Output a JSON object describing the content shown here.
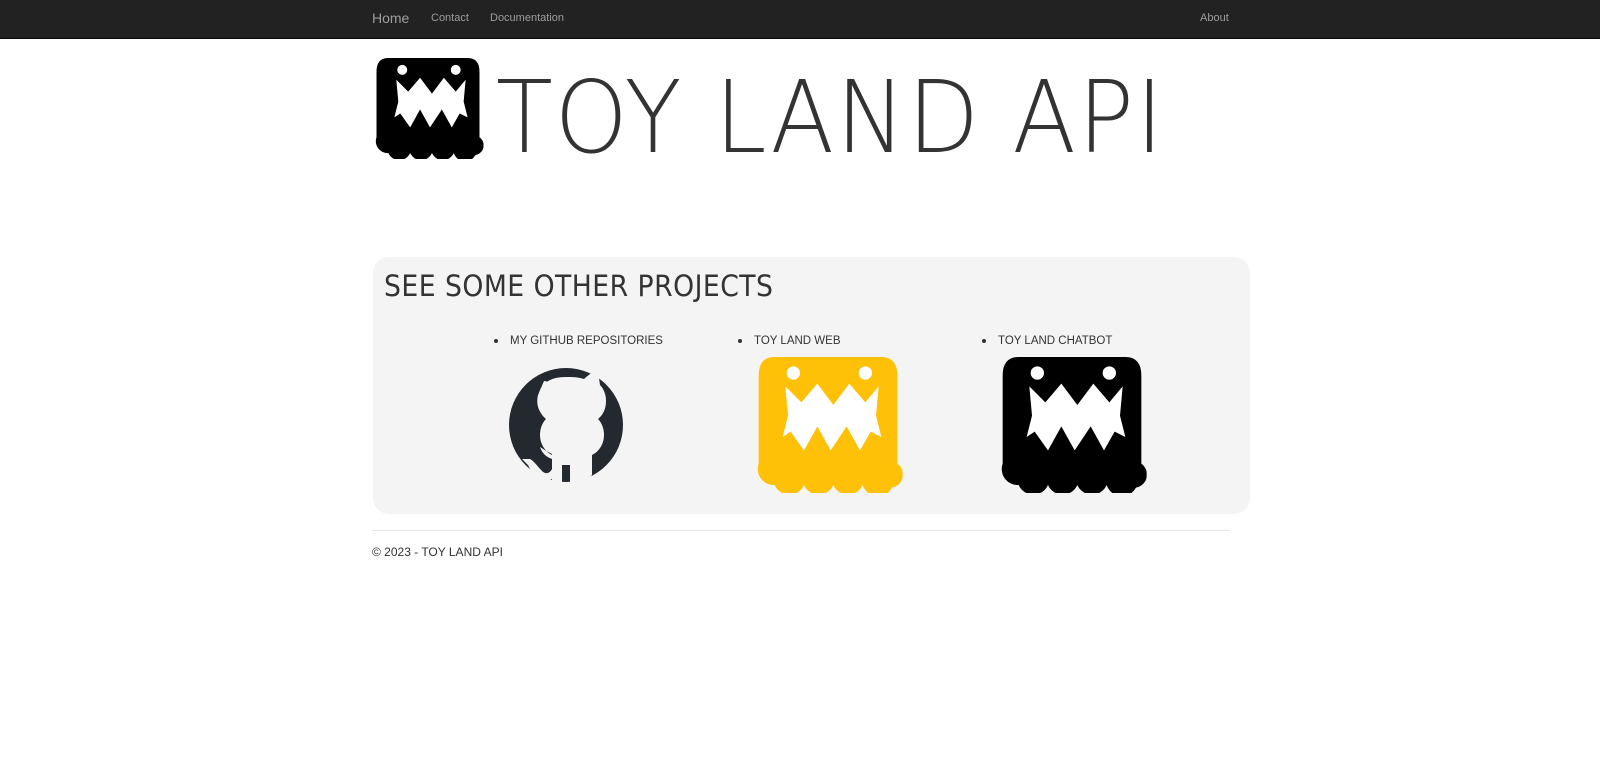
{
  "nav": {
    "brand": "Home",
    "links": [
      "Contact",
      "Documentation"
    ],
    "right_link": "About"
  },
  "hero": {
    "title": "TOY LAND API",
    "logo_icon": "toy-land-monster-logo"
  },
  "projects": {
    "heading": "SEE SOME OTHER PROJECTS",
    "items": [
      {
        "label": "MY GITHUB REPOSITORIES",
        "icon": "github-icon",
        "color": "#24292f"
      },
      {
        "label": "TOY LAND WEB",
        "icon": "toy-land-web-icon",
        "color": "#ffc107"
      },
      {
        "label": "TOY LAND CHATBOT",
        "icon": "toy-land-chatbot-icon",
        "color": "#000000"
      }
    ]
  },
  "footer": {
    "text": "© 2023 - TOY LAND API"
  },
  "colors": {
    "navbar": "#222222",
    "nav_text": "#9d9d9d",
    "panel": "#f4f4f4",
    "text": "#333333"
  }
}
